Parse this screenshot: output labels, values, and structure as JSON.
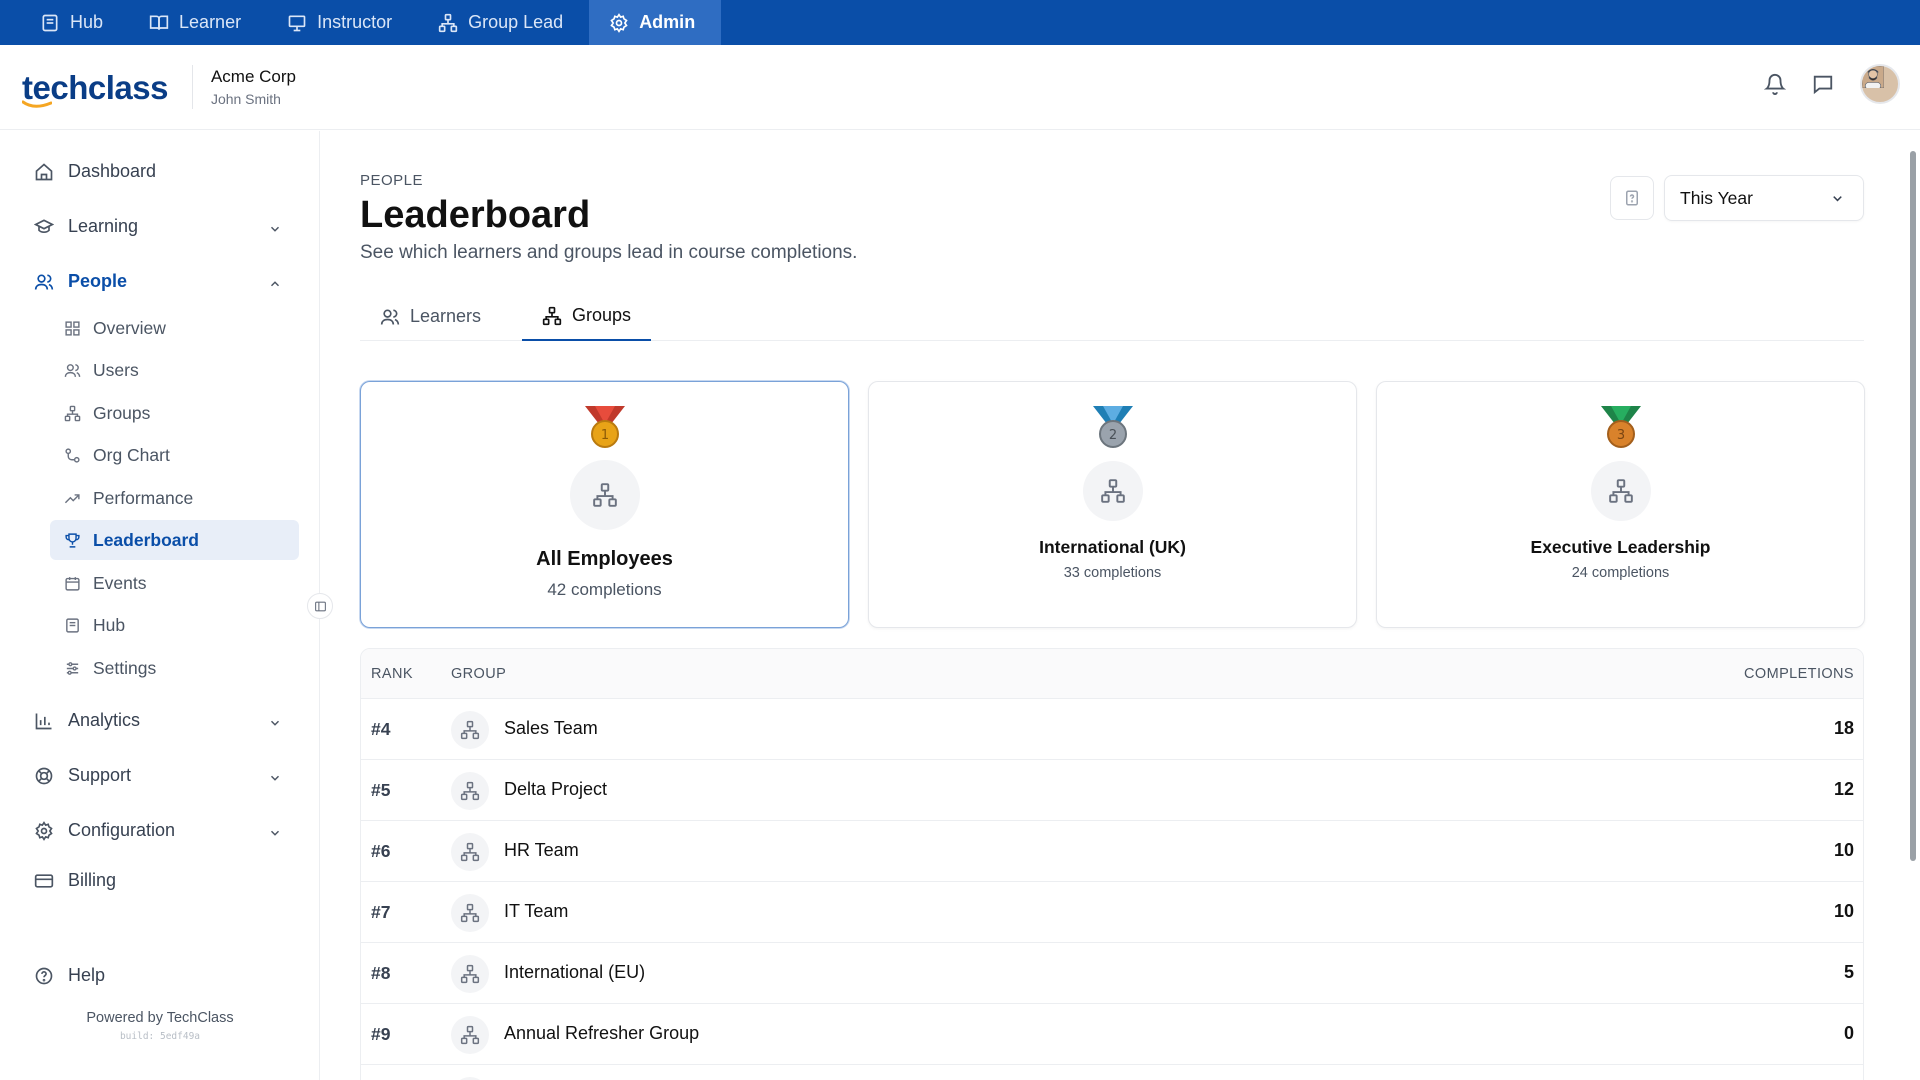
{
  "topnav": [
    {
      "label": "Hub",
      "icon": "book-icon",
      "active": false
    },
    {
      "label": "Learner",
      "icon": "open-book-icon",
      "active": false
    },
    {
      "label": "Instructor",
      "icon": "presentation-icon",
      "active": false
    },
    {
      "label": "Group Lead",
      "icon": "group-icon",
      "active": false
    },
    {
      "label": "Admin",
      "icon": "gear-icon",
      "active": true
    }
  ],
  "header": {
    "logo": "techclass",
    "org_name": "Acme Corp",
    "user_name": "John Smith"
  },
  "sidebar": {
    "items": [
      {
        "label": "Dashboard",
        "icon": "home-icon"
      },
      {
        "label": "Learning",
        "icon": "graduation-cap-icon"
      },
      {
        "label": "People",
        "icon": "users-icon"
      },
      {
        "label": "Analytics",
        "icon": "bar-chart-icon"
      },
      {
        "label": "Support",
        "icon": "lifebuoy-icon"
      },
      {
        "label": "Configuration",
        "icon": "gear-icon"
      },
      {
        "label": "Billing",
        "icon": "credit-card-icon"
      },
      {
        "label": "Help",
        "icon": "help-circle-icon"
      }
    ],
    "people_sub": [
      {
        "label": "Overview",
        "icon": "grid-icon"
      },
      {
        "label": "Users",
        "icon": "users-icon"
      },
      {
        "label": "Groups",
        "icon": "network-icon"
      },
      {
        "label": "Org Chart",
        "icon": "org-chart-icon"
      },
      {
        "label": "Performance",
        "icon": "trending-up-icon"
      },
      {
        "label": "Leaderboard",
        "icon": "trophy-icon"
      },
      {
        "label": "Events",
        "icon": "calendar-icon"
      },
      {
        "label": "Hub",
        "icon": "book-icon"
      },
      {
        "label": "Settings",
        "icon": "sliders-icon"
      }
    ],
    "powered_by": "Powered by TechClass",
    "build": "build: 5edf49a"
  },
  "page": {
    "breadcrumb": "PEOPLE",
    "title": "Leaderboard",
    "subtitle": "See which learners and groups lead in course completions.",
    "period": "This Year",
    "tabs": [
      {
        "label": "Learners",
        "active": false
      },
      {
        "label": "Groups",
        "active": true
      }
    ]
  },
  "podium": [
    {
      "rank": 1,
      "name": "All Employees",
      "completions": "42 completions",
      "medal_color": "#e8a317"
    },
    {
      "rank": 2,
      "name": "International (UK)",
      "completions": "33 completions",
      "medal_color": "#9aa3ad"
    },
    {
      "rank": 3,
      "name": "Executive Leadership",
      "completions": "24 completions",
      "medal_color": "#d9822b"
    }
  ],
  "table": {
    "headers": {
      "rank": "RANK",
      "group": "GROUP",
      "completions": "COMPLETIONS"
    },
    "rows": [
      {
        "rank": "#4",
        "name": "Sales Team",
        "completions": "18"
      },
      {
        "rank": "#5",
        "name": "Delta Project",
        "completions": "12"
      },
      {
        "rank": "#6",
        "name": "HR Team",
        "completions": "10"
      },
      {
        "rank": "#7",
        "name": "IT Team",
        "completions": "10"
      },
      {
        "rank": "#8",
        "name": "International (EU)",
        "completions": "5"
      },
      {
        "rank": "#9",
        "name": "Annual Refresher Group",
        "completions": "0"
      }
    ]
  },
  "colors": {
    "brand": "#0a4ea8",
    "accent": "#f5a623"
  }
}
